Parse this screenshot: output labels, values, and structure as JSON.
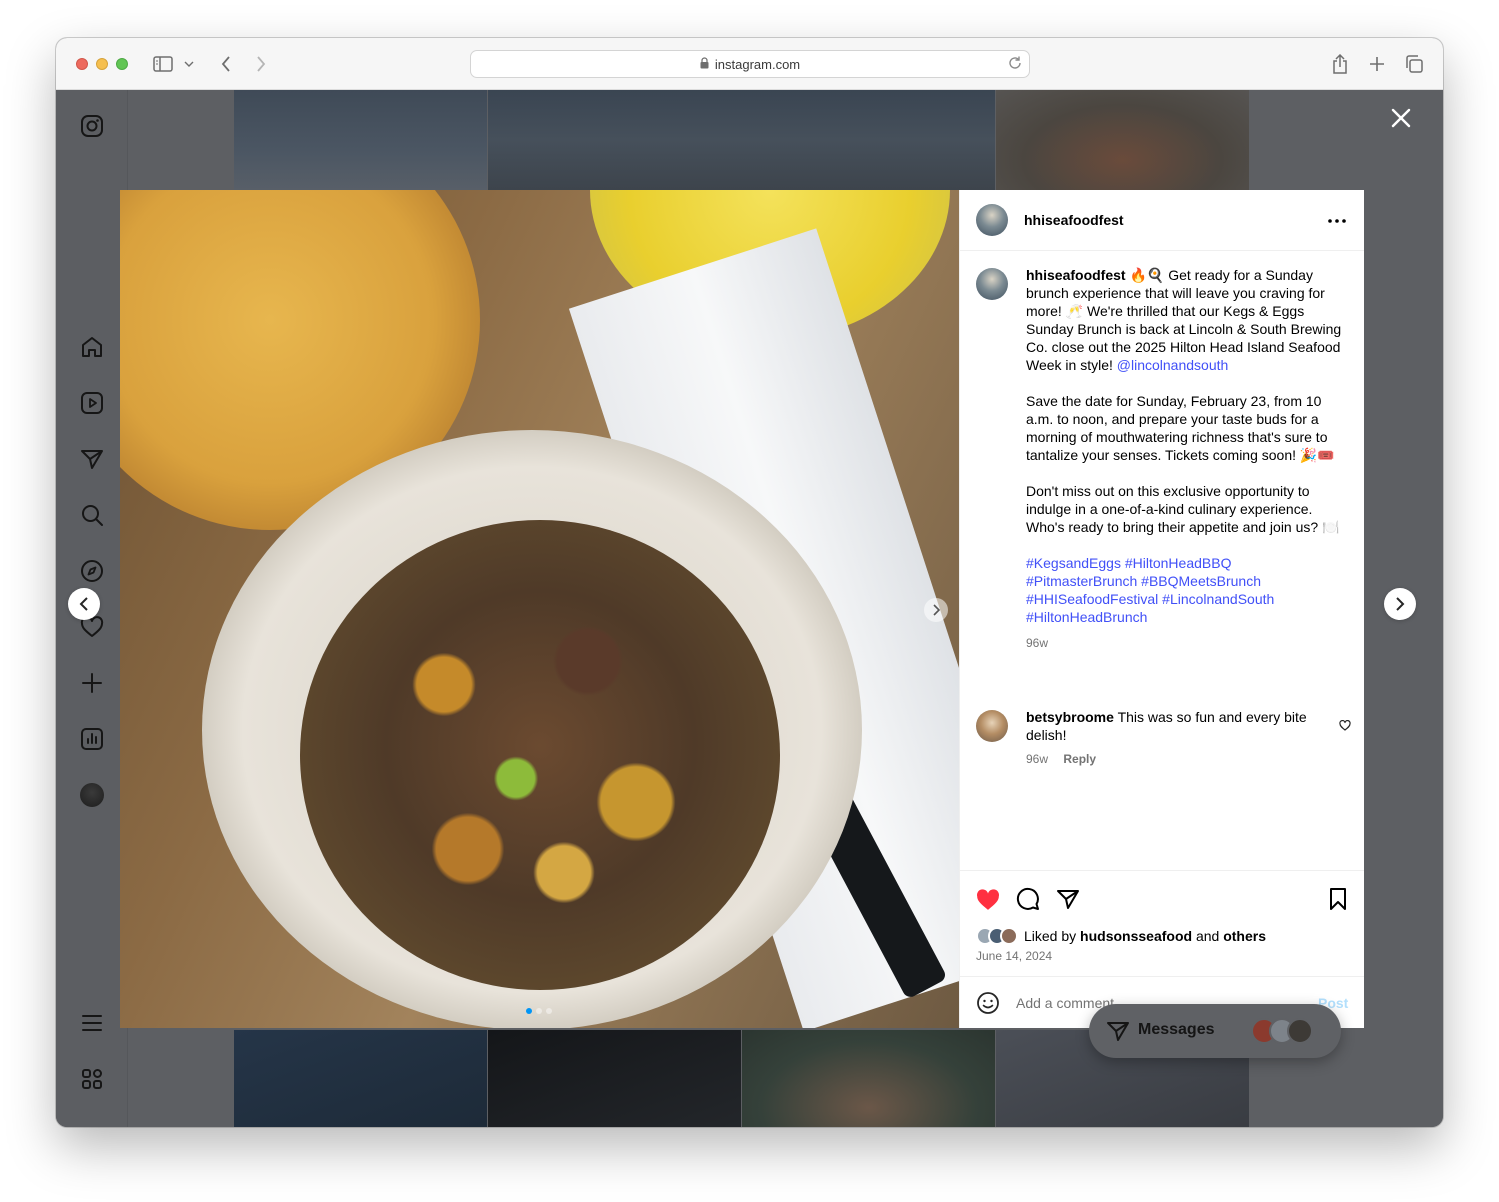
{
  "browser": {
    "url": "instagram.com"
  },
  "post": {
    "username": "hhiseafoodfest",
    "caption": {
      "line1_after_user": "🔥🍳 Get ready for a Sunday brunch experience that will leave you craving for more! 🥂 We're thrilled that our Kegs & Eggs Sunday Brunch is back at Lincoln & South Brewing Co. close out the 2025 Hilton Head Island Seafood Week in style!",
      "mention": "@lincolnandsouth",
      "para2": "Save the date for Sunday, February 23, from 10 a.m. to noon, and prepare your taste buds for a morning of mouthwatering richness that's sure to tantalize your senses. Tickets coming soon! 🎉🎟️",
      "para3": "Don't miss out on this exclusive opportunity to indulge in a one-of-a-kind culinary experience. Who's ready to bring their appetite and join us? 🍽️",
      "hashtags": "#KegsandEggs #HiltonHeadBBQ #PitmasterBrunch #BBQMeetsBrunch #HHISeafoodFestival #LincolnandSouth #HiltonHeadBrunch",
      "age": "96w"
    },
    "comments": [
      {
        "username": "betsybroome",
        "text": "This was so fun and every bite delish!",
        "age": "96w",
        "reply_label": "Reply"
      }
    ],
    "likes": {
      "prefix": "Liked by",
      "user": "hudsonsseafood",
      "joiner": "and",
      "others": "others"
    },
    "date": "June 14, 2024",
    "liked": true,
    "carousel": {
      "count": 3,
      "active_index": 0
    }
  },
  "comment_box": {
    "placeholder": "Add a comment…",
    "post_label": "Post"
  },
  "messages": {
    "label": "Messages"
  },
  "colors": {
    "like_red": "#ff3040",
    "link_blue": "#4150f7",
    "post_disabled": "#b2dffc",
    "dim_background": "#5d5f63"
  },
  "icons": {
    "left_nav": [
      "instagram-logo-icon",
      "home-icon",
      "reels-icon",
      "direct-icon",
      "search-icon",
      "explore-icon",
      "heart-icon",
      "create-icon",
      "insights-icon",
      "profile-avatar",
      "menu-icon",
      "also-from-meta-icon"
    ],
    "actions": [
      "heart-filled-icon",
      "comment-icon",
      "share-icon",
      "bookmark-icon"
    ]
  }
}
